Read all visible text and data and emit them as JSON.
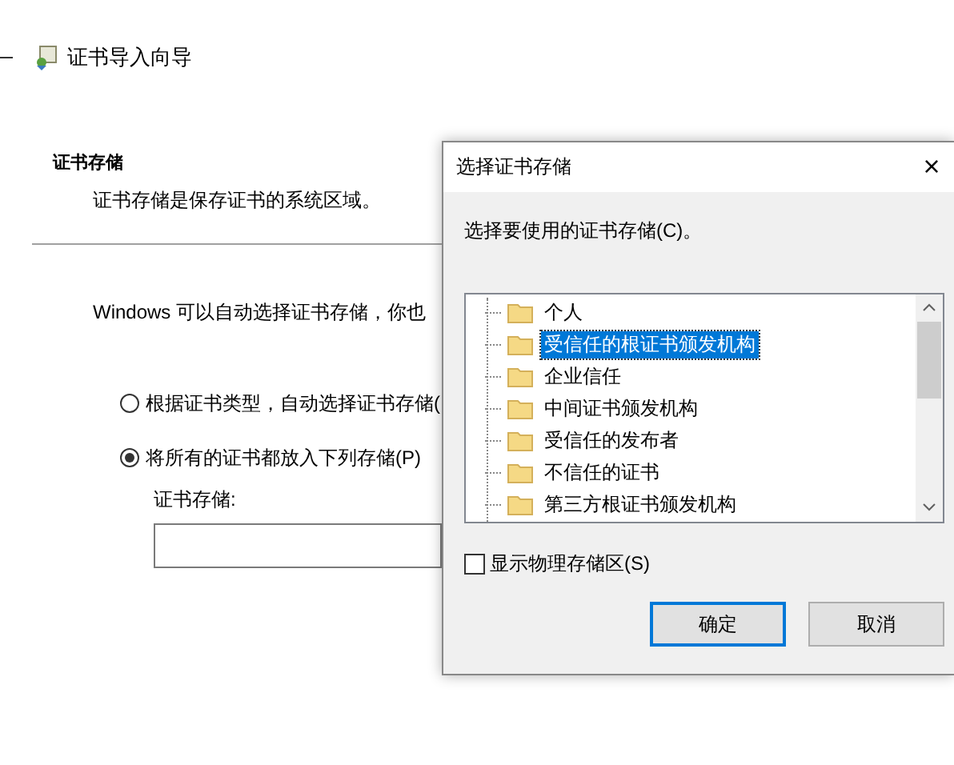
{
  "wizard": {
    "title": "证书导入向导",
    "section_title": "证书存储",
    "section_description": "证书存储是保存证书的系统区域。",
    "intro": "Windows 可以自动选择证书存储，你也",
    "options": [
      {
        "label": "根据证书类型，自动选择证书存储(",
        "selected": false
      },
      {
        "label": "将所有的证书都放入下列存储(P)",
        "selected": true
      }
    ],
    "store_label": "证书存储:"
  },
  "dialog": {
    "title": "选择证书存储",
    "close": "×",
    "prompt": "选择要使用的证书存储(C)。",
    "stores": [
      {
        "label": "个人",
        "selected": false
      },
      {
        "label": "受信任的根证书颁发机构",
        "selected": true
      },
      {
        "label": "企业信任",
        "selected": false
      },
      {
        "label": "中间证书颁发机构",
        "selected": false
      },
      {
        "label": "受信任的发布者",
        "selected": false
      },
      {
        "label": "不信任的证书",
        "selected": false
      },
      {
        "label": "第三方根证书颁发机构",
        "selected": false
      }
    ],
    "show_physical": {
      "label": "显示物理存储区(S)",
      "checked": false
    },
    "buttons": [
      {
        "label": "确定",
        "default": true
      },
      {
        "label": "取消",
        "default": false
      }
    ]
  }
}
